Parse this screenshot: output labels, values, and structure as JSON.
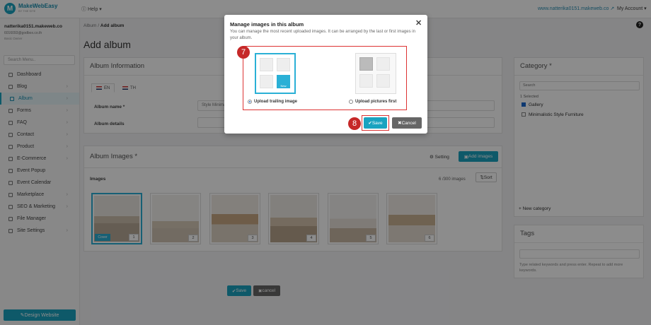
{
  "topbar": {
    "logo_letter": "M",
    "logo_name": "MakeWebEasy",
    "logo_sub": "BY THE SITE",
    "help": "Help",
    "site_link": "www.natterika0151.makeweb.co",
    "account": "My Account"
  },
  "sidebar": {
    "user_name": "natterika0151.makeweb.co",
    "user_email": "6016093@godbox.co.th",
    "user_plan": "Basic Owner",
    "search_placeholder": "Search Menu..",
    "items": [
      {
        "label": "Dashboard",
        "chevron": ""
      },
      {
        "label": "Blog",
        "chevron": "›"
      },
      {
        "label": "Album",
        "chevron": "›"
      },
      {
        "label": "Forms",
        "chevron": "›"
      },
      {
        "label": "FAQ",
        "chevron": "›"
      },
      {
        "label": "Contact",
        "chevron": "›"
      },
      {
        "label": "Product",
        "chevron": "›"
      },
      {
        "label": "E-Commerce",
        "chevron": "›"
      },
      {
        "label": "Event Popup",
        "chevron": ""
      },
      {
        "label": "Event Calendar",
        "chevron": ""
      },
      {
        "label": "Marketplace",
        "chevron": "›"
      },
      {
        "label": "SEO & Marketing",
        "chevron": "›"
      },
      {
        "label": "File Manager",
        "chevron": ""
      },
      {
        "label": "Site Settings",
        "chevron": "›"
      }
    ],
    "design_button": "Design Website"
  },
  "breadcrumb": {
    "parent": "Album",
    "sep": "/",
    "current": "Add album"
  },
  "page_title": "Add album",
  "help_icon": "?",
  "album_info": {
    "title": "Album Information",
    "tabs": [
      {
        "label": "EN"
      },
      {
        "label": "TH"
      }
    ],
    "name_label": "Album name *",
    "name_value": "Style Minimal",
    "details_label": "Album details"
  },
  "album_images": {
    "title": "Album Images *",
    "setting": "Setting",
    "add_images": "Add images",
    "images_label": "Images",
    "count": "6 /300 images",
    "sort": "Sort",
    "cover_label": "Cover",
    "thumbs": [
      {
        "num": "1"
      },
      {
        "num": "2"
      },
      {
        "num": "3"
      },
      {
        "num": "4"
      },
      {
        "num": "5"
      },
      {
        "num": "6"
      }
    ]
  },
  "bottom": {
    "save": "Save",
    "cancel": "cancel"
  },
  "category": {
    "title": "Category *",
    "search_placeholder": "Search",
    "selected": "1 Selected",
    "items": [
      {
        "label": "Gallery",
        "checked": true
      },
      {
        "label": "Minimalistic Style Furniture",
        "checked": false
      }
    ],
    "new": "+ New category"
  },
  "tags": {
    "title": "Tags",
    "hint": "Type related keywords and press enter. Repeat to add more keywords."
  },
  "modal": {
    "title": "Manage images in this album",
    "close": "✕",
    "desc": "You can manage the most recent uploaded images. It can be arranged by the last or first images in your album.",
    "step7": "7",
    "step8": "8",
    "option1": "Upload trailing image",
    "option2": "Upload pictures first",
    "option1_selected": true,
    "new_badge": "New",
    "save": "Save",
    "cancel": "Cancel"
  },
  "colors": {
    "accent": "#1aa3c0",
    "highlight": "#d33333",
    "step_badge": "#c62828",
    "cancel_btn": "#666666"
  }
}
